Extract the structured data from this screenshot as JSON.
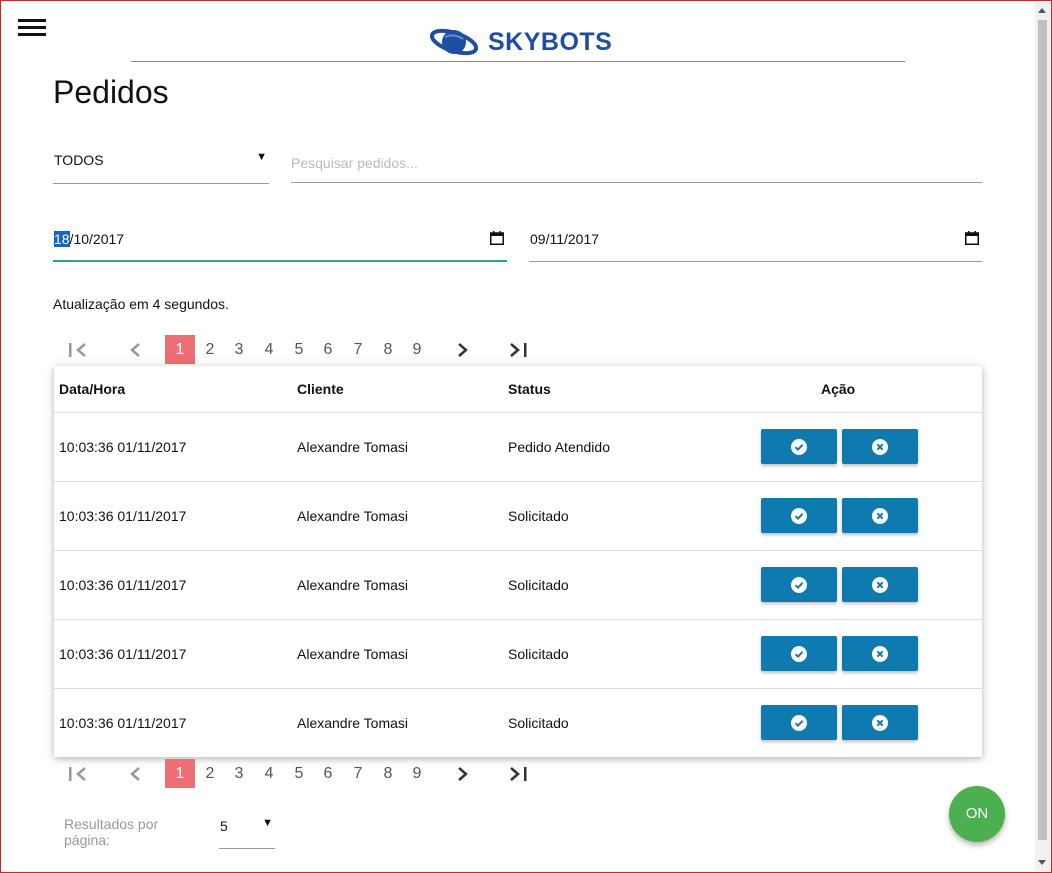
{
  "header": {
    "brand": "SKYBOTS"
  },
  "page_title": "Pedidos",
  "filters": {
    "status_selected": "TODOS",
    "search_placeholder": "Pesquisar pedidos...",
    "date_from_day": "18",
    "date_from_rest": "/10/2017",
    "date_to": "09/11/2017"
  },
  "refresh_note": "Atualização em 4 segundos.",
  "pagination": {
    "current_page": 1,
    "pages": [
      "1",
      "2",
      "3",
      "4",
      "5",
      "6",
      "7",
      "8",
      "9"
    ]
  },
  "table": {
    "headers": {
      "datetime": "Data/Hora",
      "client": "Cliente",
      "status": "Status",
      "action": "Ação"
    },
    "rows": [
      {
        "datetime": "10:03:36 01/11/2017",
        "client": "Alexandre Tomasi",
        "status": "Pedido Atendido"
      },
      {
        "datetime": "10:03:36 01/11/2017",
        "client": "Alexandre Tomasi",
        "status": "Solicitado"
      },
      {
        "datetime": "10:03:36 01/11/2017",
        "client": "Alexandre Tomasi",
        "status": "Solicitado"
      },
      {
        "datetime": "10:03:36 01/11/2017",
        "client": "Alexandre Tomasi",
        "status": "Solicitado"
      },
      {
        "datetime": "10:03:36 01/11/2017",
        "client": "Alexandre Tomasi",
        "status": "Solicitado"
      }
    ]
  },
  "results_per_page": {
    "label": "Resultados por página:",
    "value": "5"
  },
  "fab": {
    "label": "ON"
  },
  "colors": {
    "accent_teal": "#26a69a",
    "action_blue": "#0f7ab0",
    "page_active": "#ee6e73",
    "fab_green": "#4caf50",
    "brand_blue": "#1f4ea0"
  }
}
